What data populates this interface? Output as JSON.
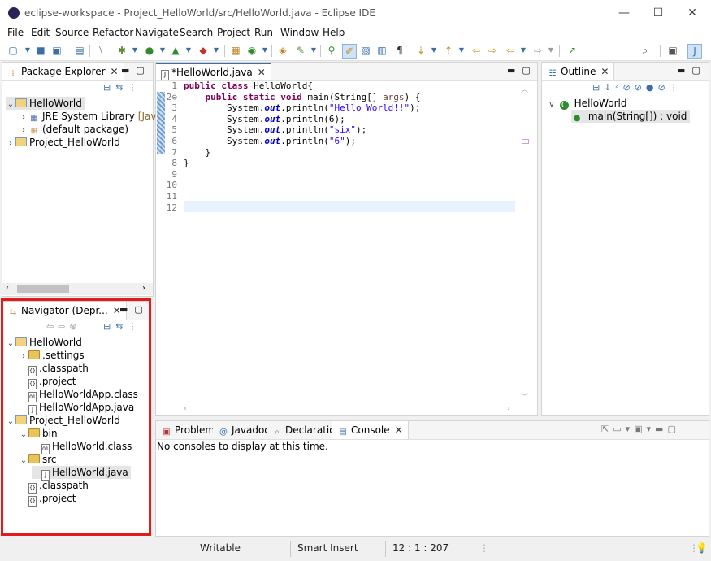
{
  "window": {
    "title": "eclipse-workspace - Project_HelloWorld/src/HelloWorld.java - Eclipse IDE",
    "minimize": "—",
    "maximize": "☐",
    "close": "✕"
  },
  "menu": [
    "File",
    "Edit",
    "Source",
    "Refactor",
    "Navigate",
    "Search",
    "Project",
    "Run",
    "Window",
    "Help"
  ],
  "package_explorer": {
    "tab_label": "Package Explorer",
    "tree": [
      {
        "label": "HelloWorld",
        "indent": 0,
        "twisty": "v",
        "icon": "project-icon",
        "selected": true
      },
      {
        "label": "JRE System Library",
        "suffix": "[JavaSE-",
        "indent": 1,
        "twisty": ">",
        "icon": "library-icon"
      },
      {
        "label": "(default package)",
        "indent": 1,
        "twisty": ">",
        "icon": "package-icon"
      },
      {
        "label": "Project_HelloWorld",
        "indent": 0,
        "twisty": ">",
        "icon": "project-icon"
      }
    ]
  },
  "navigator": {
    "tab_label": "Navigator (Depr...",
    "tree": [
      {
        "label": "HelloWorld",
        "indent": 0,
        "twisty": "v",
        "icon": "project-icon"
      },
      {
        "label": ".settings",
        "indent": 1,
        "twisty": ">",
        "icon": "folder-icon"
      },
      {
        "label": ".classpath",
        "indent": 1,
        "twisty": "",
        "icon": "xml-file-icon"
      },
      {
        "label": ".project",
        "indent": 1,
        "twisty": "",
        "icon": "xml-file-icon"
      },
      {
        "label": "HelloWorldApp.class",
        "indent": 1,
        "twisty": "",
        "icon": "class-file-icon"
      },
      {
        "label": "HelloWorldApp.java",
        "indent": 1,
        "twisty": "",
        "icon": "java-file-icon"
      },
      {
        "label": "Project_HelloWorld",
        "indent": 0,
        "twisty": "v",
        "icon": "project-icon"
      },
      {
        "label": "bin",
        "indent": 1,
        "twisty": "v",
        "icon": "folder-icon"
      },
      {
        "label": "HelloWorld.class",
        "indent": 2,
        "twisty": "",
        "icon": "class-file-icon"
      },
      {
        "label": "src",
        "indent": 1,
        "twisty": "v",
        "icon": "folder-icon"
      },
      {
        "label": "HelloWorld.java",
        "indent": 2,
        "twisty": "",
        "icon": "java-file-icon",
        "selected": true
      },
      {
        "label": ".classpath",
        "indent": 1,
        "twisty": "",
        "icon": "xml-file-icon"
      },
      {
        "label": ".project",
        "indent": 1,
        "twisty": "",
        "icon": "xml-file-icon"
      }
    ]
  },
  "editor": {
    "tab_label": "*HelloWorld.java",
    "line_numbers": [
      "1",
      "2⊖",
      "3",
      "4",
      "5",
      "6",
      "7",
      "8",
      "9",
      "10",
      "11",
      "12"
    ],
    "lines": [
      [
        {
          "t": "public class ",
          "c": "kw"
        },
        {
          "t": "HelloWorld{",
          "c": ""
        }
      ],
      [
        {
          "t": "    ",
          "c": ""
        },
        {
          "t": "public static void ",
          "c": "kw"
        },
        {
          "t": "main(String[] ",
          "c": ""
        },
        {
          "t": "args",
          "c": "arg"
        },
        {
          "t": ") {",
          "c": ""
        }
      ],
      [
        {
          "t": "        System.",
          "c": ""
        },
        {
          "t": "out",
          "c": "fld"
        },
        {
          "t": ".println(",
          "c": ""
        },
        {
          "t": "\"Hello World!!\"",
          "c": "str"
        },
        {
          "t": ");",
          "c": ""
        }
      ],
      [
        {
          "t": "        System.",
          "c": ""
        },
        {
          "t": "out",
          "c": "fld"
        },
        {
          "t": ".println(6);",
          "c": ""
        }
      ],
      [
        {
          "t": "        System.",
          "c": ""
        },
        {
          "t": "out",
          "c": "fld"
        },
        {
          "t": ".println(",
          "c": ""
        },
        {
          "t": "\"six\"",
          "c": "str"
        },
        {
          "t": ");",
          "c": ""
        }
      ],
      [
        {
          "t": "        System.",
          "c": ""
        },
        {
          "t": "out",
          "c": "fld"
        },
        {
          "t": ".println(",
          "c": ""
        },
        {
          "t": "\"6\"",
          "c": "str"
        },
        {
          "t": ");",
          "c": ""
        }
      ],
      [
        {
          "t": "    }",
          "c": ""
        }
      ],
      [
        {
          "t": "}",
          "c": ""
        }
      ],
      [],
      [],
      [],
      []
    ]
  },
  "outline": {
    "tab_label": "Outline",
    "class_name": "HelloWorld",
    "method": "main(String[]) : void"
  },
  "console": {
    "tabs": [
      "Problems",
      "Javadoc",
      "Declaration",
      "Console"
    ],
    "message": "No consoles to display at this time."
  },
  "status": {
    "writable": "Writable",
    "insert_mode": "Smart Insert",
    "position": "12 : 1 : 207"
  },
  "colors": {
    "keyword": "#7f0055",
    "string": "#2a00ff",
    "field": "#0000c0",
    "highlight_box": "#e21a1a",
    "current_line": "#e8f2fe"
  }
}
